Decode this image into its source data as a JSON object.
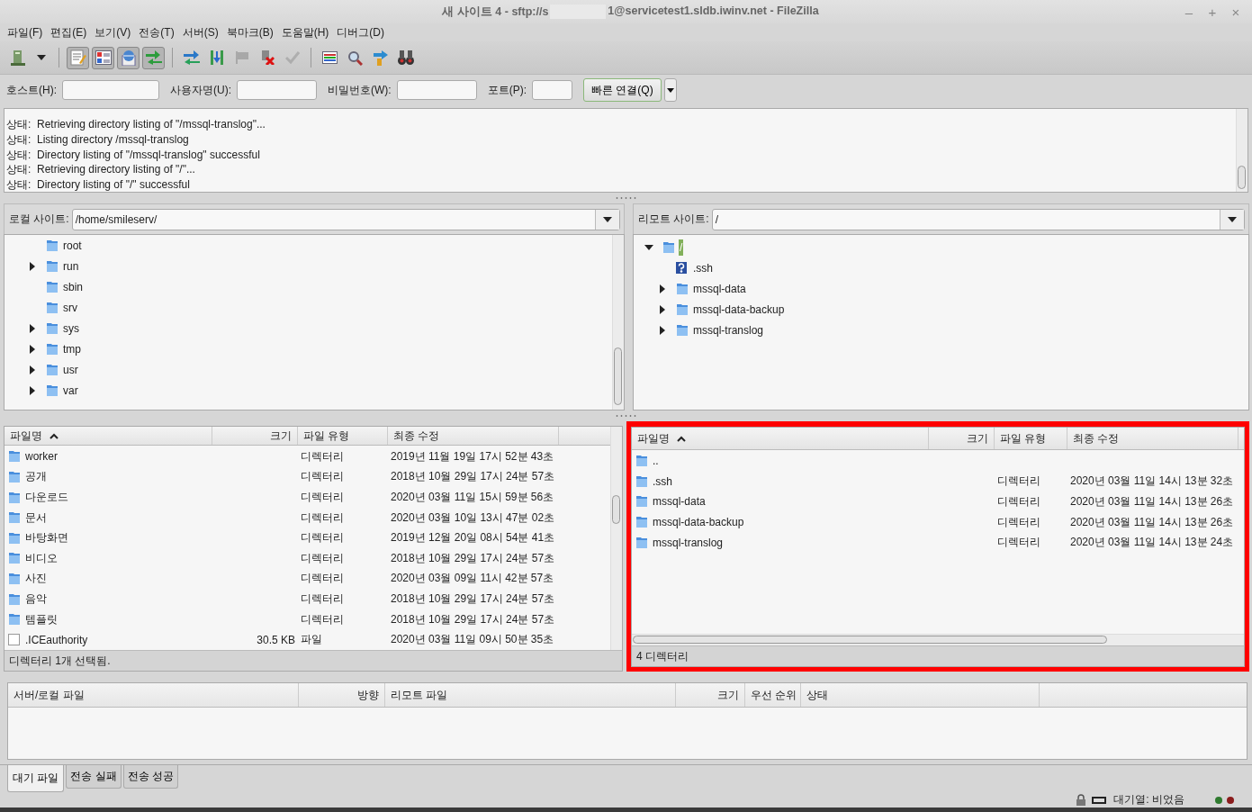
{
  "window": {
    "title_parts": [
      "새 사이트 4 - sftp://s",
      "1@servicetest1.sldb.iwinv.net - FileZilla"
    ],
    "controls": [
      "–",
      "+",
      "×"
    ]
  },
  "menu": [
    "파일(F)",
    "편집(E)",
    "보기(V)",
    "전송(T)",
    "서버(S)",
    "북마크(B)",
    "도움말(H)",
    "디버그(D)"
  ],
  "toolbar": [
    {
      "kind": "button",
      "pressed": false,
      "disabled": false
    },
    {
      "kind": "dropdown",
      "pressed": false,
      "disabled": false
    },
    {
      "kind": "separator"
    },
    {
      "kind": "button",
      "pressed": true,
      "disabled": false
    },
    {
      "kind": "button",
      "pressed": true,
      "disabled": false
    },
    {
      "kind": "button",
      "pressed": true,
      "disabled": false
    },
    {
      "kind": "button",
      "pressed": true,
      "disabled": false
    },
    {
      "kind": "separator"
    },
    {
      "kind": "button",
      "pressed": false,
      "disabled": false
    },
    {
      "kind": "button",
      "pressed": false,
      "disabled": false
    },
    {
      "kind": "button",
      "pressed": false,
      "disabled": true
    },
    {
      "kind": "button",
      "pressed": false,
      "disabled": false
    },
    {
      "kind": "button",
      "pressed": false,
      "disabled": true
    },
    {
      "kind": "separator"
    },
    {
      "kind": "button",
      "pressed": false,
      "disabled": false
    },
    {
      "kind": "button",
      "pressed": false,
      "disabled": false
    },
    {
      "kind": "button",
      "pressed": false,
      "disabled": false
    },
    {
      "kind": "button",
      "pressed": false,
      "disabled": false
    }
  ],
  "quickconnect": {
    "fields": [
      {
        "label": "호스트(H):"
      },
      {
        "label": "사용자명(U):"
      },
      {
        "label": "비밀번호(W):"
      },
      {
        "label": "포트(P):"
      }
    ],
    "button": "빠른 연결(Q)"
  },
  "log": [
    {
      "prefix": "상태:",
      "message": "Retrieving directory listing of \"/mssql-translog\"..."
    },
    {
      "prefix": "상태:",
      "message": "Listing directory /mssql-translog"
    },
    {
      "prefix": "상태:",
      "message": "Directory listing of \"/mssql-translog\" successful"
    },
    {
      "prefix": "상태:",
      "message": "Retrieving directory listing of \"/\"..."
    },
    {
      "prefix": "상태:",
      "message": "Directory listing of \"/\" successful"
    }
  ],
  "local_site": {
    "label": "로컬 사이트:",
    "path": "/home/smileserv/",
    "tree": [
      {
        "name": "root",
        "kind": "folder",
        "expandable": false,
        "selected": false
      },
      {
        "name": "run",
        "kind": "folder",
        "expandable": true,
        "expanded": false,
        "selected": false
      },
      {
        "name": "sbin",
        "kind": "folder",
        "expandable": false,
        "selected": false
      },
      {
        "name": "srv",
        "kind": "folder",
        "expandable": false,
        "selected": false
      },
      {
        "name": "sys",
        "kind": "folder",
        "expandable": true,
        "expanded": false,
        "selected": false
      },
      {
        "name": "tmp",
        "kind": "folder",
        "expandable": true,
        "expanded": false,
        "selected": false
      },
      {
        "name": "usr",
        "kind": "folder",
        "expandable": true,
        "expanded": false,
        "selected": false
      },
      {
        "name": "var",
        "kind": "folder",
        "expandable": true,
        "expanded": false,
        "selected": false
      }
    ]
  },
  "remote_site": {
    "label": "리모트 사이트:",
    "path": "/",
    "tree": [
      {
        "name": "/",
        "kind": "folder",
        "expandable": true,
        "expanded": true,
        "selected": true,
        "children": [
          {
            "name": ".ssh",
            "kind": "unknown",
            "expandable": false,
            "selected": false
          },
          {
            "name": "mssql-data",
            "kind": "folder",
            "expandable": true,
            "expanded": false,
            "selected": false
          },
          {
            "name": "mssql-data-backup",
            "kind": "folder",
            "expandable": true,
            "expanded": false,
            "selected": false
          },
          {
            "name": "mssql-translog",
            "kind": "folder",
            "expandable": true,
            "expanded": false,
            "selected": false
          }
        ]
      }
    ]
  },
  "local_files": {
    "highlighted": false,
    "columns": [
      {
        "label": "파일명",
        "sorted": true
      },
      {
        "label": "크기",
        "sorted": false
      },
      {
        "label": "파일 유형",
        "sorted": false
      },
      {
        "label": "최종 수정",
        "sorted": false
      }
    ],
    "rows": [
      {
        "kind": "folder",
        "name": "worker",
        "type": "디렉터리",
        "modified": "2019년 11월 19일 17시 52분 43초"
      },
      {
        "kind": "folder",
        "name": "공개",
        "type": "디렉터리",
        "modified": "2018년 10월 29일 17시 24분 57초"
      },
      {
        "kind": "folder",
        "name": "다운로드",
        "type": "디렉터리",
        "modified": "2020년 03월 11일 15시 59분 56초"
      },
      {
        "kind": "folder",
        "name": "문서",
        "type": "디렉터리",
        "modified": "2020년 03월 10일 13시 47분 02초"
      },
      {
        "kind": "folder",
        "name": "바탕화면",
        "type": "디렉터리",
        "modified": "2019년 12월 20일 08시 54분 41초"
      },
      {
        "kind": "folder",
        "name": "비디오",
        "type": "디렉터리",
        "modified": "2018년 10월 29일 17시 24분 57초"
      },
      {
        "kind": "folder",
        "name": "사진",
        "type": "디렉터리",
        "modified": "2020년 03월 09일 11시 42분 57초"
      },
      {
        "kind": "folder",
        "name": "음악",
        "type": "디렉터리",
        "modified": "2018년 10월 29일 17시 24분 57초"
      },
      {
        "kind": "folder",
        "name": "템플릿",
        "type": "디렉터리",
        "modified": "2018년 10월 29일 17시 24분 57초"
      },
      {
        "kind": "file",
        "name": ".ICEauthority",
        "size": "30.5 KB",
        "type": "파일",
        "modified": "2020년 03월 11일 09시 50분 35초"
      }
    ],
    "status": "디렉터리 1개 선택됨."
  },
  "remote_files": {
    "highlighted": true,
    "columns": [
      {
        "label": "파일명",
        "sorted": true
      },
      {
        "label": "크기",
        "sorted": false
      },
      {
        "label": "파일 유형",
        "sorted": false
      },
      {
        "label": "최종 수정",
        "sorted": false
      }
    ],
    "rows": [
      {
        "kind": "folder",
        "name": ".."
      },
      {
        "kind": "folder",
        "name": ".ssh",
        "type": "디렉터리",
        "modified": "2020년 03월 11일 14시 13분 32초"
      },
      {
        "kind": "folder",
        "name": "mssql-data",
        "type": "디렉터리",
        "modified": "2020년 03월 11일 14시 13분 26초"
      },
      {
        "kind": "folder",
        "name": "mssql-data-backup",
        "type": "디렉터리",
        "modified": "2020년 03월 11일 14시 13분 26초"
      },
      {
        "kind": "folder",
        "name": "mssql-translog",
        "type": "디렉터리",
        "modified": "2020년 03월 11일 14시 13분 24초"
      }
    ],
    "status": "4 디렉터리"
  },
  "queue": {
    "columns": [
      "서버/로컬 파일",
      "방향",
      "리모트 파일",
      "크기",
      "우선 순위",
      "상태"
    ],
    "tabs": [
      {
        "label": "대기 파일",
        "selected": true
      },
      {
        "label": "전송 실패",
        "selected": false
      },
      {
        "label": "전송 성공",
        "selected": false
      }
    ]
  },
  "status_bar": {
    "queue": "대기열: 비었음",
    "indicators": [
      {
        "color": "#2f7a2f"
      },
      {
        "color": "#8a1c1c"
      }
    ]
  }
}
